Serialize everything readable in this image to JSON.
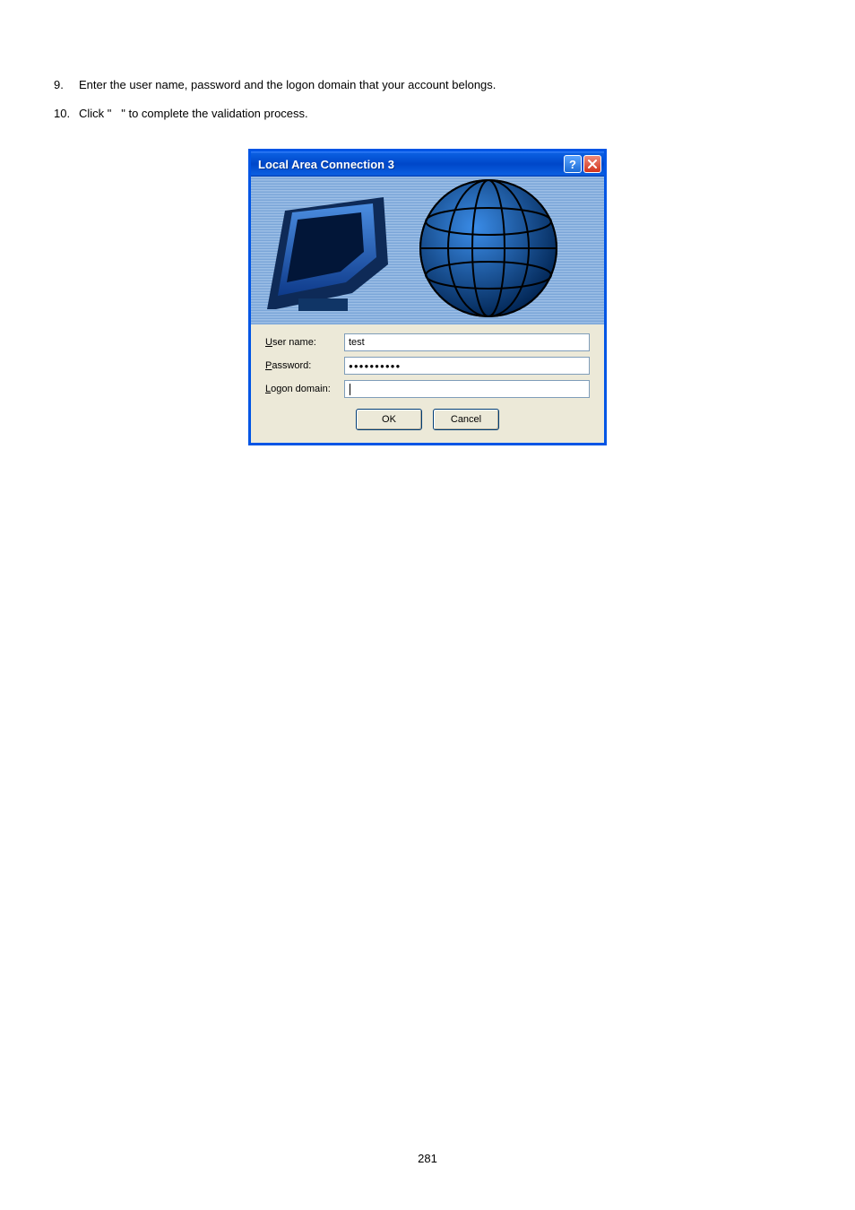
{
  "list": {
    "item9": {
      "num": "9.",
      "text": "Enter the user name, password and the logon domain that your account belongs."
    },
    "item10": {
      "num": "10.",
      "text_a": "Click \"",
      "text_b": "\" to complete the validation process."
    }
  },
  "dialog": {
    "title": "Local Area Connection 3",
    "help": "?",
    "close": "X",
    "labels": {
      "username_rest": "ser name:",
      "password_rest": "assword:",
      "logon_rest": "ogon domain:"
    },
    "values": {
      "username": "test",
      "password": "●●●●●●●●●●",
      "logon": ""
    },
    "buttons": {
      "ok": "OK",
      "cancel": "Cancel"
    }
  },
  "page_number": "281"
}
